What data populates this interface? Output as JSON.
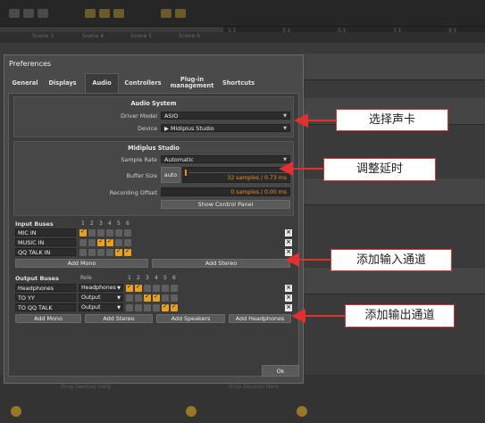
{
  "background": {
    "scenes": [
      "Scene 3",
      "Scene 4",
      "Scene 5",
      "Scene 6"
    ],
    "ruler_marks": [
      "1.1",
      "3.1",
      "5.1",
      "7.1",
      "9.1"
    ],
    "drop_devices": [
      "Drop Devices Here",
      "Drop Devices Here"
    ]
  },
  "dialog": {
    "title": "Preferences",
    "tabs": [
      "General",
      "Displays",
      "Audio",
      "Controllers",
      "Plug-in\nmanagement",
      "Shortcuts"
    ],
    "active_tab": "Audio",
    "audio_system": {
      "title": "Audio System",
      "driver_label": "Driver Model",
      "driver_value": "ASIO",
      "device_label": "Device",
      "device_value": "▶ Midiplus Studio"
    },
    "device_section": {
      "title": "Midiplus Studio",
      "sample_rate_label": "Sample Rate",
      "sample_rate_value": "Automatic",
      "buffer_label": "Buffer Size",
      "buffer_auto": "auto",
      "buffer_value": "32 samples / 0.73 ms",
      "offset_label": "Recording Offset",
      "offset_value": "0 samples / 0.00 ms",
      "control_panel_button": "Show Control Panel"
    },
    "input_buses": {
      "title": "Input Buses",
      "channel_numbers": [
        "1",
        "2",
        "3",
        "4",
        "5",
        "6"
      ],
      "rows": [
        {
          "name": "MIC IN",
          "checks": [
            true,
            false,
            false,
            false,
            false,
            false
          ]
        },
        {
          "name": "MUSIC IN",
          "checks": [
            false,
            false,
            true,
            true,
            false,
            false
          ]
        },
        {
          "name": "QQ TALK IN",
          "checks": [
            false,
            false,
            false,
            false,
            true,
            true
          ]
        }
      ],
      "add_mono": "Add Mono",
      "add_stereo": "Add Stereo"
    },
    "output_buses": {
      "title": "Output Buses",
      "role_header": "Role",
      "channel_numbers": [
        "1",
        "2",
        "3",
        "4",
        "5",
        "6"
      ],
      "rows": [
        {
          "name": "Headphones",
          "role": "Headphones",
          "checks": [
            true,
            true,
            false,
            false,
            false,
            false
          ]
        },
        {
          "name": "TO YY",
          "role": "Output",
          "checks": [
            false,
            false,
            true,
            true,
            false,
            false
          ]
        },
        {
          "name": "TO QQ TALK",
          "role": "Output",
          "checks": [
            false,
            false,
            false,
            false,
            true,
            true
          ]
        }
      ],
      "add_mono": "Add Mono",
      "add_stereo": "Add Stereo",
      "add_speakers": "Add Speakers",
      "add_headphones": "Add Headphones"
    },
    "ok_button": "Ok"
  },
  "annotations": {
    "select_card": "选择声卡",
    "adjust_latency": "调整延时",
    "add_input": "添加输入通道",
    "add_output": "添加输出通道"
  },
  "colors": {
    "accent": "#e8a020",
    "annotation_border": "#dd3333",
    "arrow": "#e03030"
  }
}
